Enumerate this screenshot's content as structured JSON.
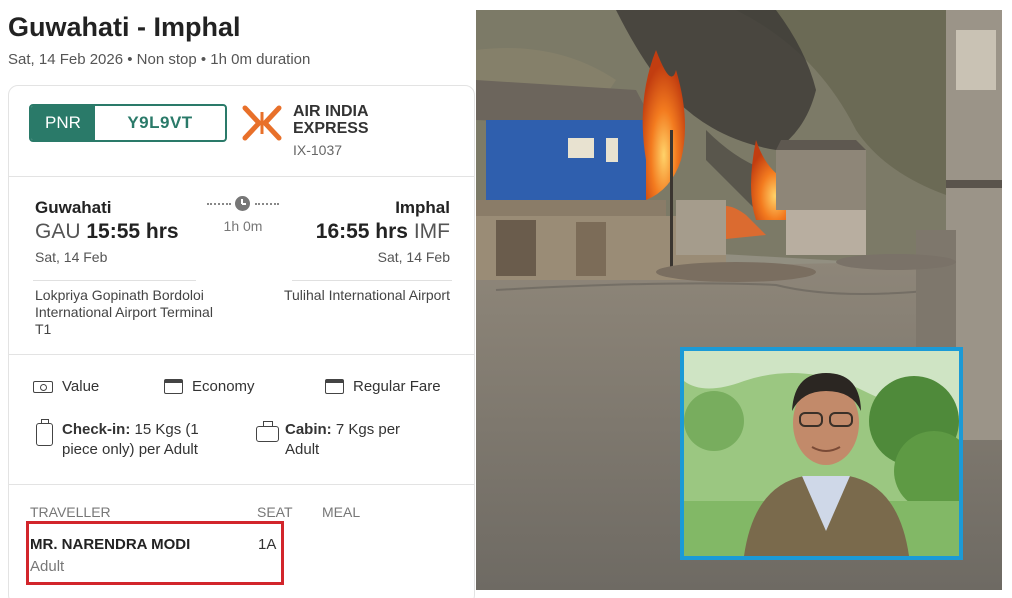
{
  "title": "Guwahati - Imphal",
  "subtitle": "Sat, 14 Feb 2026 • Non stop • 1h 0m duration",
  "pnr": {
    "label": "PNR",
    "value": "Y9L9VT"
  },
  "airline": {
    "name": "AIR INDIA EXPRESS",
    "flight_no": "IX-1037",
    "logo_color": "#e8702a"
  },
  "departure": {
    "city": "Guwahati",
    "code": "GAU",
    "time": "15:55 hrs",
    "date": "Sat, 14 Feb",
    "airport": "Lokpriya Gopinath Bordoloi International Airport Terminal T1"
  },
  "arrival": {
    "city": "Imphal",
    "code": "IMF",
    "time": "16:55 hrs",
    "date": "Sat, 14 Feb",
    "airport": "Tulihal International Airport"
  },
  "duration": "1h 0m",
  "features": [
    {
      "icon": "money-icon",
      "label": "Value"
    },
    {
      "icon": "calendar-icon",
      "label": "Economy"
    },
    {
      "icon": "calendar-icon",
      "label": "Regular Fare"
    }
  ],
  "baggage": {
    "checkin_label": "Check-in:",
    "checkin_value": "15 Kgs (1 piece only) per Adult",
    "cabin_label": "Cabin:",
    "cabin_value": "7 Kgs per Adult"
  },
  "traveller_table": {
    "headers": [
      "TRAVELLER",
      "SEAT",
      "MEAL"
    ],
    "rows": [
      {
        "name": "MR. NARENDRA MODI",
        "type": "Adult",
        "seat": "1A",
        "meal": ""
      }
    ]
  },
  "colors": {
    "pnr_green": "#2a7a69",
    "highlight_red": "#d2252b",
    "inset_border": "#1b9ad6"
  }
}
